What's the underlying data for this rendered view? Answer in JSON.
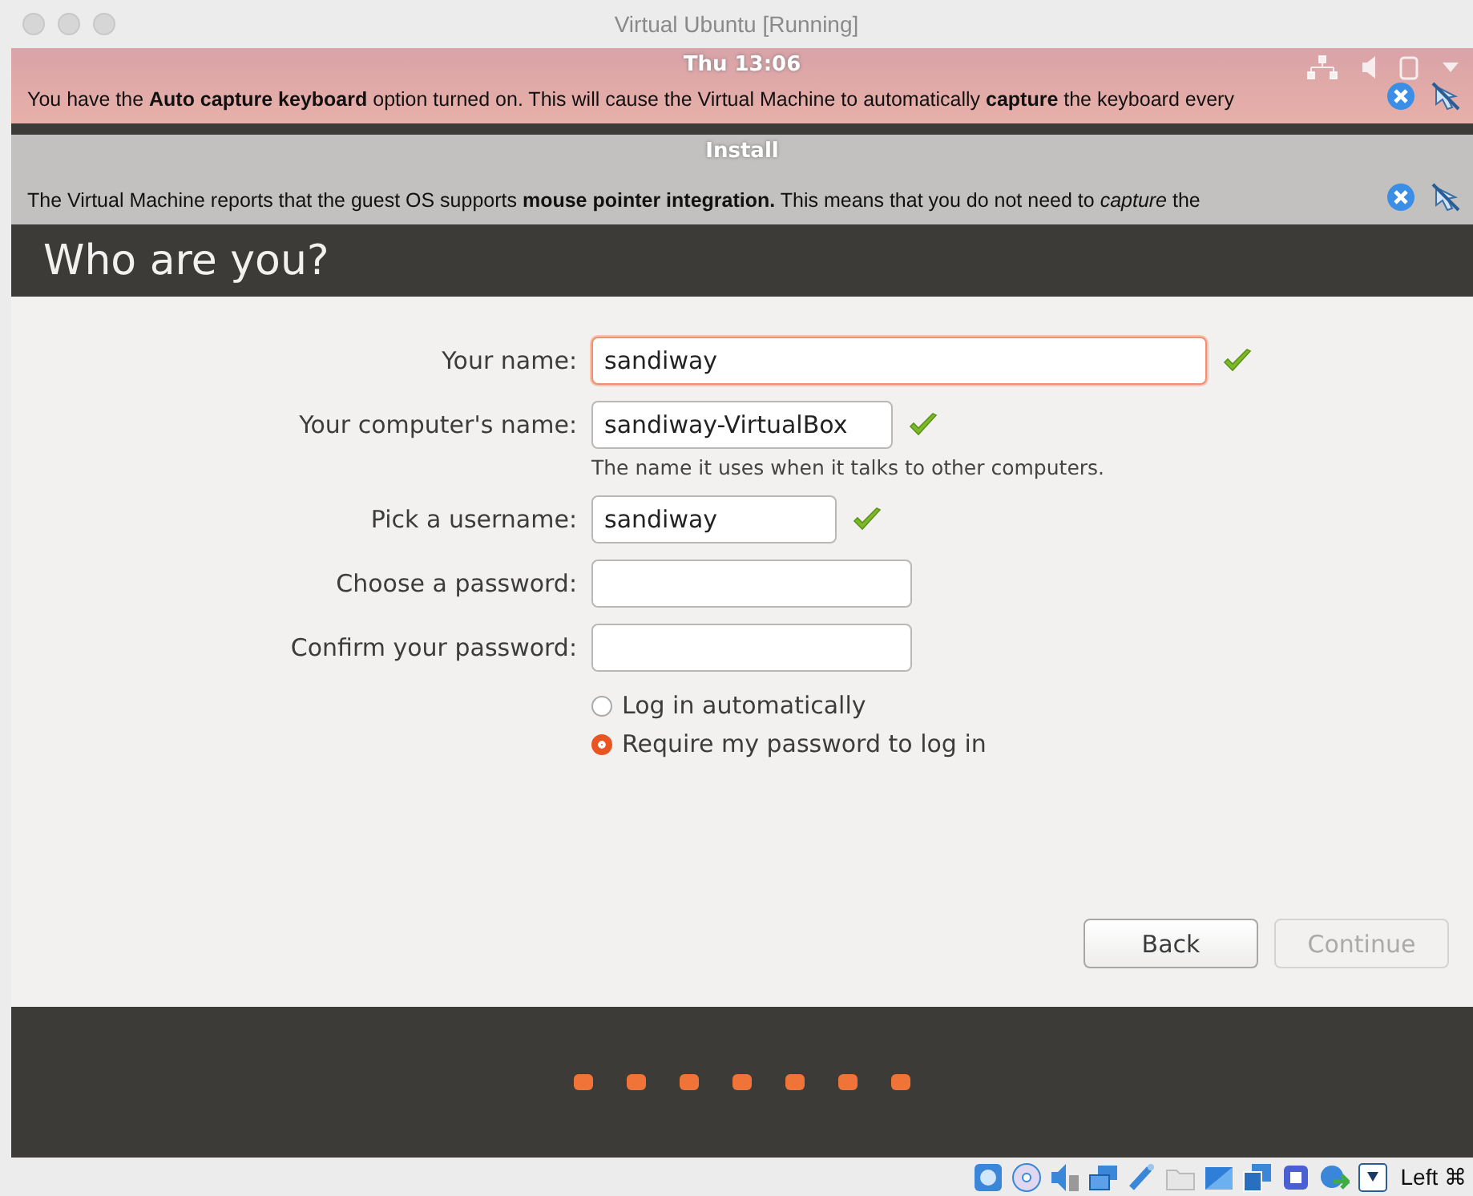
{
  "window": {
    "title": "Virtual Ubuntu [Running]"
  },
  "top_panel": {
    "clock": "Thu 13:06"
  },
  "notifications": [
    {
      "kind": "keyboard",
      "text": "You have the **Auto capture keyboard** option turned on. This will cause the Virtual Machine to automatically **capture** the keyboard every"
    },
    {
      "kind": "mouse",
      "text": "The Virtual Machine reports that the guest OS supports **mouse pointer integration.** This means that you do not need to *capture* the"
    }
  ],
  "installer": {
    "title": "Install",
    "heading": "Who are you?",
    "fields": [
      {
        "label": "Your name:",
        "value": "sandiway",
        "focused": true,
        "valid": true
      },
      {
        "label": "Your computer's name:",
        "value": "sandiway-VirtualBox",
        "focused": false,
        "valid": true,
        "hint": "The name it uses when it talks to other computers."
      },
      {
        "label": "Pick a username:",
        "value": "sandiway",
        "focused": false,
        "valid": true
      },
      {
        "label": "Choose a password:",
        "focused": false,
        "valid": false
      },
      {
        "label": "Confirm your password:",
        "focused": false,
        "valid": false
      }
    ],
    "login_options": [
      {
        "label": "Log in automatically",
        "selected": false
      },
      {
        "label": "Require my password to log in",
        "selected": true
      }
    ],
    "buttons": [
      {
        "label": "Back",
        "disabled": false
      },
      {
        "label": "Continue",
        "disabled": true
      }
    ]
  },
  "status_bar": {
    "host_key": "Left ⌘"
  }
}
